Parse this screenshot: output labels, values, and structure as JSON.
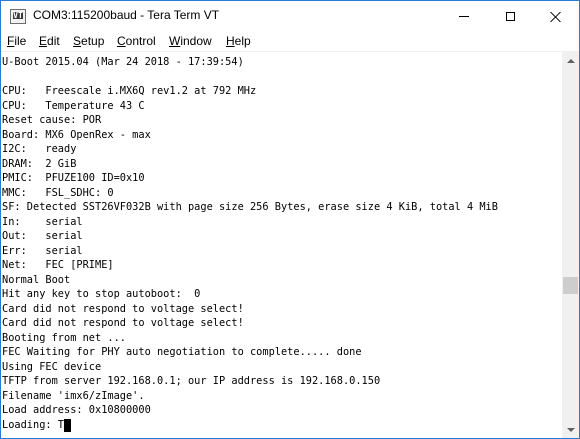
{
  "window": {
    "title": "COM3:115200baud - Tera Term VT",
    "icon_label": "VT"
  },
  "menu": [
    {
      "accel": "F",
      "rest": "ile"
    },
    {
      "accel": "E",
      "rest": "dit"
    },
    {
      "accel": "S",
      "rest": "etup"
    },
    {
      "accel": "C",
      "rest": "ontrol"
    },
    {
      "accel": "W",
      "rest": "indow"
    },
    {
      "accel": "H",
      "rest": "elp"
    }
  ],
  "terminal": {
    "lines": [
      "U-Boot 2015.04 (Mar 24 2018 - 17:39:54)",
      "",
      "CPU:   Freescale i.MX6Q rev1.2 at 792 MHz",
      "CPU:   Temperature 43 C",
      "Reset cause: POR",
      "Board: MX6 OpenRex - max",
      "I2C:   ready",
      "DRAM:  2 GiB",
      "PMIC:  PFUZE100 ID=0x10",
      "MMC:   FSL_SDHC: 0",
      "SF: Detected SST26VF032B with page size 256 Bytes, erase size 4 KiB, total 4 MiB",
      "In:    serial",
      "Out:   serial",
      "Err:   serial",
      "Net:   FEC [PRIME]",
      "Normal Boot",
      "Hit any key to stop autoboot:  0",
      "Card did not respond to voltage select!",
      "Card did not respond to voltage select!",
      "Booting from net ...",
      "FEC Waiting for PHY auto negotiation to complete..... done",
      "Using FEC device",
      "TFTP from server 192.168.0.1; our IP address is 192.168.0.150",
      "Filename 'imx6/zImage'.",
      "Load address: 0x10800000",
      "Loading: T"
    ],
    "cursor_line": 25,
    "cursor_col": 10
  },
  "scrollbar": {
    "position": 0.62
  },
  "colors": {
    "window_border": "#2b79d6",
    "background": "#ffffff",
    "text": "#000000",
    "scrollbar_track": "#f0f0f0",
    "scrollbar_thumb": "#cdcdcd"
  }
}
